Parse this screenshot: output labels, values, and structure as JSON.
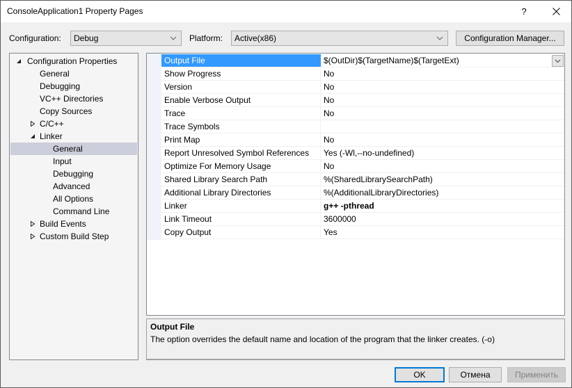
{
  "window": {
    "title": "ConsoleApplication1 Property Pages",
    "help_label": "?",
    "close_icon": "close-icon"
  },
  "toolbar": {
    "configuration_label": "Configuration:",
    "configuration_value": "Debug",
    "platform_label": "Platform:",
    "platform_value": "Active(x86)",
    "config_manager_label": "Configuration Manager..."
  },
  "tree": {
    "items": [
      {
        "label": "Configuration Properties",
        "level": 0,
        "toggle": "expanded"
      },
      {
        "label": "General",
        "level": 1,
        "toggle": "none"
      },
      {
        "label": "Debugging",
        "level": 1,
        "toggle": "none"
      },
      {
        "label": "VC++ Directories",
        "level": 1,
        "toggle": "none"
      },
      {
        "label": "Copy Sources",
        "level": 1,
        "toggle": "none"
      },
      {
        "label": "C/C++",
        "level": 1,
        "toggle": "collapsed"
      },
      {
        "label": "Linker",
        "level": 1,
        "toggle": "expanded"
      },
      {
        "label": "General",
        "level": 2,
        "toggle": "none",
        "selected": true
      },
      {
        "label": "Input",
        "level": 2,
        "toggle": "none"
      },
      {
        "label": "Debugging",
        "level": 2,
        "toggle": "none"
      },
      {
        "label": "Advanced",
        "level": 2,
        "toggle": "none"
      },
      {
        "label": "All Options",
        "level": 2,
        "toggle": "none"
      },
      {
        "label": "Command Line",
        "level": 2,
        "toggle": "none"
      },
      {
        "label": "Build Events",
        "level": 1,
        "toggle": "collapsed"
      },
      {
        "label": "Custom Build Step",
        "level": 1,
        "toggle": "collapsed"
      }
    ]
  },
  "properties": {
    "rows": [
      {
        "name": "Output File",
        "value": "$(OutDir)$(TargetName)$(TargetExt)",
        "selected": true,
        "bold": false
      },
      {
        "name": "Show Progress",
        "value": "No",
        "bold": false
      },
      {
        "name": "Version",
        "value": "No",
        "bold": false
      },
      {
        "name": "Enable Verbose Output",
        "value": "No",
        "bold": false
      },
      {
        "name": "Trace",
        "value": "No",
        "bold": false
      },
      {
        "name": "Trace Symbols",
        "value": "",
        "bold": false
      },
      {
        "name": "Print Map",
        "value": "No",
        "bold": false
      },
      {
        "name": "Report Unresolved Symbol References",
        "value": "Yes (-Wl,--no-undefined)",
        "bold": false
      },
      {
        "name": "Optimize For Memory Usage",
        "value": "No",
        "bold": false
      },
      {
        "name": "Shared Library Search Path",
        "value": "%(SharedLibrarySearchPath)",
        "bold": false
      },
      {
        "name": "Additional Library Directories",
        "value": "%(AdditionalLibraryDirectories)",
        "bold": false
      },
      {
        "name": "Linker",
        "value": "g++ -pthread",
        "bold": true
      },
      {
        "name": "Link Timeout",
        "value": "3600000",
        "bold": false
      },
      {
        "name": "Copy Output",
        "value": "Yes",
        "bold": false
      }
    ]
  },
  "description": {
    "title": "Output File",
    "text": "The option overrides the default name and location of the program that the linker creates. (-o)"
  },
  "buttons": {
    "ok": "OK",
    "cancel": "Отмена",
    "apply": "Применить"
  },
  "colors": {
    "selection": "#3399ff",
    "tree_selection": "#cccedb",
    "focus_border": "#0078d7"
  }
}
